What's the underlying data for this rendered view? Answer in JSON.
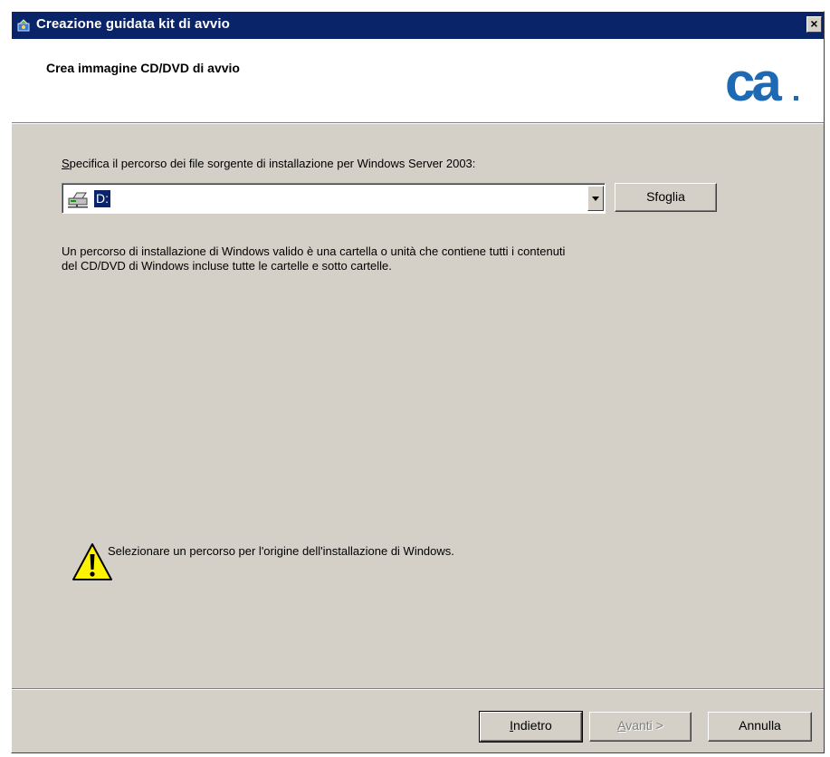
{
  "window": {
    "title": "Creazione guidata kit di avvio",
    "close_glyph": "×"
  },
  "header": {
    "title": "Crea immagine CD/DVD di avvio",
    "logo_text": "ca",
    "logo_color": "#1d69b3"
  },
  "source": {
    "label_mnemonic": "S",
    "label_rest": "pecifica il percorso dei file sorgente di installazione per Windows Server 2003:",
    "combo_value": "D:",
    "drive_icon": "network-drive-icon",
    "browse_button": "Sfoglia"
  },
  "info": {
    "line1": "Un percorso di installazione di Windows valido è una cartella o unità che contiene tutti i contenuti",
    "line2": "del CD/DVD di Windows incluse tutte le cartelle e sotto cartelle."
  },
  "warning": {
    "icon": "warning-icon",
    "text": "Selezionare un percorso per l'origine dell'installazione di Windows."
  },
  "footer": {
    "back_mnemonic": "I",
    "back_rest": "ndietro",
    "next_mnemonic": "A",
    "next_rest": "vanti >",
    "cancel": "Annulla"
  },
  "colors": {
    "titlebar": "#0a246a",
    "dialog_face": "#d4d0c8",
    "selection": "#0a246a"
  }
}
